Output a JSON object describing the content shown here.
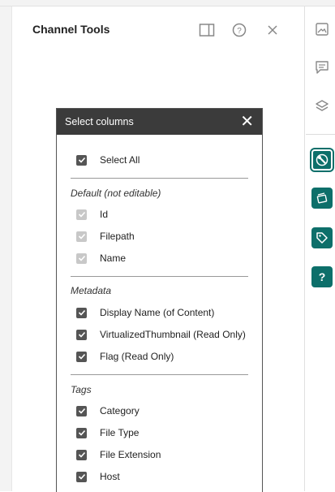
{
  "panel": {
    "title": "Channel Tools"
  },
  "header_icons": [
    "panel-toggle-icon",
    "help-circle-icon",
    "close-icon"
  ],
  "rail_icons": [
    "image-icon",
    "comment-icon",
    "layers-icon",
    "tools-icon",
    "channel-icon",
    "tag-icon",
    "help-icon"
  ],
  "dialog": {
    "title": "Select columns",
    "select_all": "Select All",
    "sections": [
      {
        "label": "Default (not editable)",
        "items": [
          "Id",
          "Filepath",
          "Name"
        ]
      },
      {
        "label": "Metadata",
        "items": [
          "Display Name (of Content)",
          "VirtualizedThumbnail (Read Only)",
          "Flag (Read Only)"
        ]
      },
      {
        "label": "Tags",
        "items": [
          "Category",
          "File Type",
          "File Extension",
          "Host"
        ]
      }
    ]
  },
  "colors": {
    "accent": "#0d6f6a",
    "dialog_header": "#3b3b3b",
    "checkbox_checked": "#555555",
    "checkbox_disabled": "#c8c8c8"
  }
}
